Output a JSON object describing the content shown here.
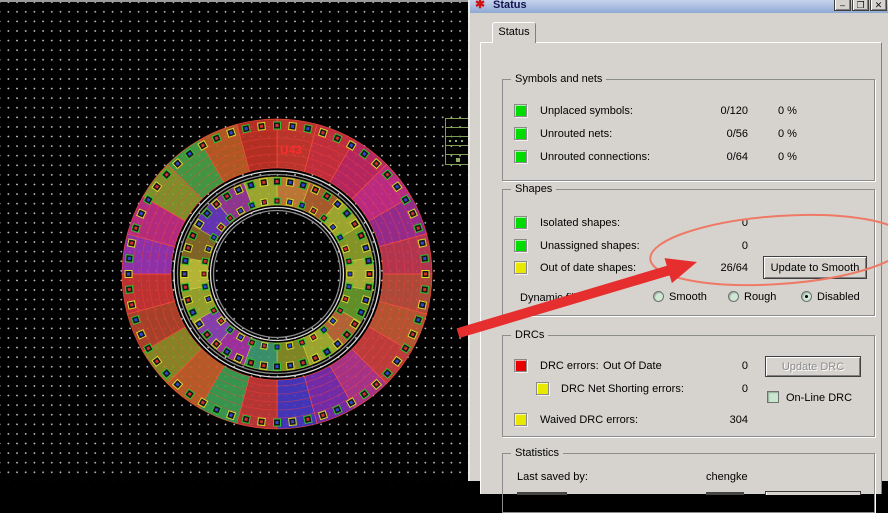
{
  "window": {
    "title": "Status",
    "controls": {
      "minimize": "–",
      "maximize": "❐",
      "close": "✕"
    }
  },
  "tab": {
    "label": "Status"
  },
  "groups": {
    "symbols_and_nets": {
      "title": "Symbols and nets",
      "rows": [
        {
          "label": "Unplaced symbols:",
          "value": "0/120",
          "percent": "0 %",
          "status_color": "#00dc00"
        },
        {
          "label": "Unrouted nets:",
          "value": "0/56",
          "percent": "0 %",
          "status_color": "#00dc00"
        },
        {
          "label": "Unrouted connections:",
          "value": "0/64",
          "percent": "0 %",
          "status_color": "#00dc00"
        }
      ]
    },
    "shapes": {
      "title": "Shapes",
      "rows": [
        {
          "label": "Isolated shapes:",
          "value": "0",
          "status_color": "#00dc00"
        },
        {
          "label": "Unassigned shapes:",
          "value": "0",
          "status_color": "#00dc00"
        },
        {
          "label": "Out of date shapes:",
          "value": "26/64",
          "status_color": "#e8e800"
        }
      ],
      "update_button": "Update to Smooth",
      "dynamic_fill": {
        "label": "Dynamic fill:",
        "options": [
          "Smooth",
          "Rough",
          "Disabled"
        ],
        "selected": "Disabled"
      }
    },
    "drcs": {
      "title": "DRCs",
      "row1": {
        "label": "DRC errors:",
        "sublabel": "Out Of Date",
        "value": "0",
        "status_color": "#e60000"
      },
      "row2": {
        "label": "DRC Net Shorting errors:",
        "value": "0",
        "status_color": "#e8e800"
      },
      "row3": {
        "label": "Waived DRC errors:",
        "value": "304",
        "status_color": "#e8e800"
      },
      "update_button": "Update DRC",
      "online_drc_label": "On-Line DRC"
    },
    "statistics": {
      "title": "Statistics",
      "rows": [
        {
          "label": "Last saved by:",
          "value": "chengke"
        }
      ]
    }
  },
  "annotations": {
    "circle_color": "#ee7a66",
    "arrow_color": "#e62e2e"
  },
  "pcb": {
    "label": {
      "text": "U43",
      "color": "#ff2a2a"
    },
    "center": [
      277,
      272
    ],
    "outer_ring": {
      "r_outer": 155,
      "r_inner": 106,
      "colors": [
        "#c93a30",
        "#cf3340",
        "#c22a66",
        "#c92f8c",
        "#a12f96",
        "#c03a55",
        "#bb4f3d",
        "#c25b35",
        "#cc4040",
        "#b23790",
        "#7c2fb2",
        "#4a3ac6",
        "#c43838",
        "#3da052",
        "#c2622a",
        "#8f8f28",
        "#b5452d",
        "#cc3636",
        "#9a35b5",
        "#c22f88",
        "#8a9a2e",
        "#49a246",
        "#bf5f26",
        "#c23326"
      ]
    },
    "inner_ring": {
      "r_outer": 97,
      "r_inner": 69,
      "colors": [
        "#c9803a",
        "#b2622e",
        "#a8b232",
        "#8fa02a",
        "#b0b83a",
        "#6a9a2e",
        "#c26a3a",
        "#a8b232",
        "#8a8f28",
        "#3f9a72",
        "#a834a8",
        "#8f44b8",
        "#a0aa30",
        "#c2c23a",
        "#8a6a28",
        "#6a38c0",
        "#9a3a9a",
        "#a8b232"
      ]
    },
    "guide_circles": [
      {
        "r": 103,
        "color": "#d8d8d8"
      },
      {
        "r": 99.5,
        "color": "#8a8a8a"
      },
      {
        "r": 66.5,
        "color": "#d8d8d8"
      },
      {
        "r": 63.5,
        "color": "#8a8a8a"
      }
    ],
    "pads": {
      "rings": [
        {
          "r": 148.5,
          "count": 60,
          "size": 7
        },
        {
          "r": 92.5,
          "count": 44,
          "size": 7
        },
        {
          "r": 73,
          "count": 36,
          "size": 6
        }
      ],
      "border_colors": [
        "#2ec22e",
        "#d8d82e"
      ],
      "dot_colors": [
        "#d03030",
        "#3048d0"
      ]
    },
    "trace_arcs": {
      "radii": [
        112,
        120,
        128,
        136,
        144
      ],
      "color": "rgba(255,64,64,0.45)"
    }
  }
}
